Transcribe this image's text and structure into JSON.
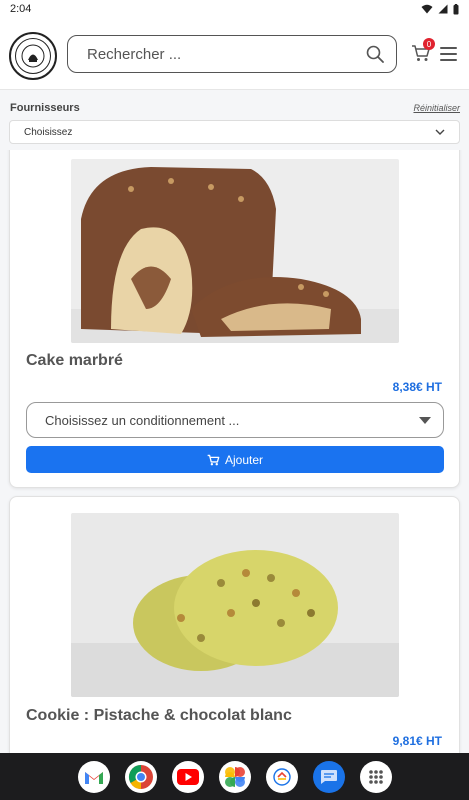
{
  "status_bar": {
    "time": "2:04"
  },
  "header": {
    "logo_text": "BOULANGERIE",
    "search_placeholder": "Rechercher ...",
    "cart_count": "0"
  },
  "filters": {
    "label": "Fournisseurs",
    "reset_label": "Réinitialiser",
    "select_value": "Choisissez"
  },
  "products": [
    {
      "name": "Cake marbré",
      "price": "8,38€ HT",
      "pack_placeholder": "Choisissez un conditionnement ...",
      "add_label": "Ajouter",
      "image_desc": "cake-marbre-image"
    },
    {
      "name": "Cookie : Pistache & chocolat blanc",
      "price": "9,81€ HT",
      "image_desc": "cookie-pistache-image"
    }
  ],
  "colors": {
    "accent": "#1a73f0",
    "price": "#1f6fe0",
    "badge": "#e0232f"
  },
  "dock_apps": [
    "gmail-icon",
    "chrome-icon",
    "youtube-icon",
    "photos-icon",
    "store-icon",
    "messages-icon",
    "apps-icon"
  ]
}
